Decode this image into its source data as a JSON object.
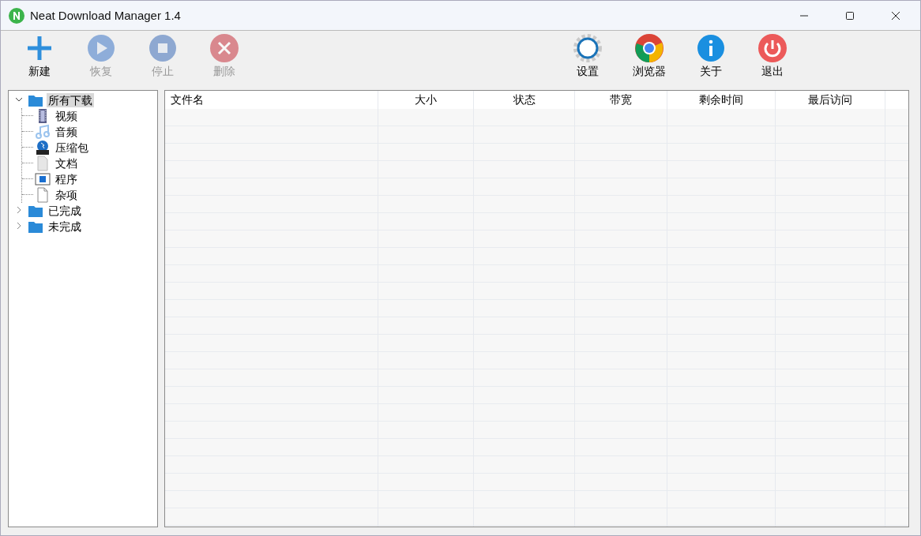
{
  "window": {
    "title": "Neat Download Manager 1.4"
  },
  "toolbar": {
    "left": [
      {
        "kind": "add",
        "label": "新建",
        "disabled": false
      },
      {
        "kind": "resume",
        "label": "恢复",
        "disabled": true
      },
      {
        "kind": "stop",
        "label": "停止",
        "disabled": true
      },
      {
        "kind": "delete",
        "label": "删除",
        "disabled": true
      }
    ],
    "right": [
      {
        "kind": "settings",
        "label": "设置",
        "disabled": false
      },
      {
        "kind": "browser",
        "label": "浏览器",
        "disabled": false
      },
      {
        "kind": "about",
        "label": "关于",
        "disabled": false
      },
      {
        "kind": "exit",
        "label": "退出",
        "disabled": false
      }
    ]
  },
  "sidebar": {
    "items": [
      {
        "kind": "folder",
        "label": "所有下载",
        "expanded": true,
        "selected": true,
        "children": [
          {
            "kind": "video",
            "label": "视频",
            "selected": false
          },
          {
            "kind": "audio",
            "label": "音频",
            "selected": false
          },
          {
            "kind": "zip",
            "label": "压缩包",
            "selected": false
          },
          {
            "kind": "document",
            "label": "文档",
            "selected": false
          },
          {
            "kind": "program",
            "label": "程序",
            "selected": false
          },
          {
            "kind": "misc",
            "label": "杂项",
            "selected": false
          }
        ]
      },
      {
        "kind": "folder",
        "label": "已完成",
        "expanded": false,
        "selected": false
      },
      {
        "kind": "folder",
        "label": "未完成",
        "expanded": false,
        "selected": false
      }
    ]
  },
  "table": {
    "columns": [
      {
        "label": "文件名"
      },
      {
        "label": "大小"
      },
      {
        "label": "状态"
      },
      {
        "label": "带宽"
      },
      {
        "label": "剩余时间"
      },
      {
        "label": "最后访问"
      }
    ]
  }
}
